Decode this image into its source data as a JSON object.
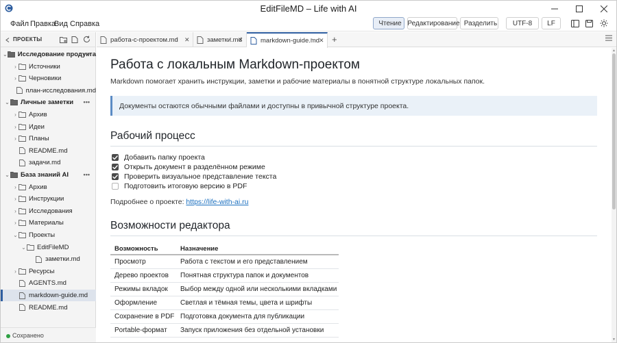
{
  "window": {
    "title": "EditFileMD – Life with AI"
  },
  "menu": [
    "Файл",
    "Правка",
    "Вид",
    "Справка"
  ],
  "toolbar": {
    "read_label": "Чтение",
    "edit_label": "Редактирование",
    "split_label": "Разделить",
    "encoding": "UTF-8",
    "line_ending": "LF"
  },
  "sidebar": {
    "title": "ПРОЕКТЫ",
    "tree": [
      {
        "label": "Исследование продукта",
        "type": "group",
        "indent": 0,
        "expanded": true
      },
      {
        "label": "Источники",
        "type": "folder",
        "indent": 1
      },
      {
        "label": "Черновики",
        "type": "folder",
        "indent": 1
      },
      {
        "label": "план-исследования.md",
        "type": "file",
        "indent": 1
      },
      {
        "label": "Личные заметки",
        "type": "group",
        "indent": 0,
        "expanded": true
      },
      {
        "label": "Архив",
        "type": "folder",
        "indent": 1
      },
      {
        "label": "Идеи",
        "type": "folder",
        "indent": 1
      },
      {
        "label": "Планы",
        "type": "folder",
        "indent": 1
      },
      {
        "label": "README.md",
        "type": "file",
        "indent": 1
      },
      {
        "label": "задачи.md",
        "type": "file",
        "indent": 1
      },
      {
        "label": "База знаний AI",
        "type": "group",
        "indent": 0,
        "expanded": true
      },
      {
        "label": "Архив",
        "type": "folder",
        "indent": 1
      },
      {
        "label": "Инструкции",
        "type": "folder",
        "indent": 1
      },
      {
        "label": "Исследования",
        "type": "folder",
        "indent": 1
      },
      {
        "label": "Материалы",
        "type": "folder",
        "indent": 1
      },
      {
        "label": "Проекты",
        "type": "folder",
        "indent": 1,
        "expanded": true
      },
      {
        "label": "EditFileMD",
        "type": "folder",
        "indent": 2,
        "expanded": true
      },
      {
        "label": "заметки.md",
        "type": "file",
        "indent": 3
      },
      {
        "label": "Ресурсы",
        "type": "folder",
        "indent": 1
      },
      {
        "label": "AGENTS.md",
        "type": "file",
        "indent": 1
      },
      {
        "label": "markdown-guide.md",
        "type": "file",
        "indent": 1,
        "selected": true
      },
      {
        "label": "README.md",
        "type": "file",
        "indent": 1
      }
    ],
    "status": "Сохранено"
  },
  "tabs": [
    {
      "label": "работа-с-проектом.md",
      "active": false
    },
    {
      "label": "заметки.md",
      "active": false
    },
    {
      "label": "markdown-guide.md",
      "active": true
    }
  ],
  "document": {
    "h1": "Работа с локальным Markdown-проектом",
    "lead": "Markdown помогает хранить инструкции, заметки и рабочие материалы в понятной структуре локальных папок.",
    "callout": "Документы остаются обычными файлами и доступны в привычной структуре проекта.",
    "h2_workflow": "Рабочий процесс",
    "tasks": [
      {
        "text": "Добавить папку проекта",
        "done": true
      },
      {
        "text": "Открыть документ в разделённом режиме",
        "done": true
      },
      {
        "text": "Проверить визуальное представление текста",
        "done": true
      },
      {
        "text": "Подготовить итоговую версию в PDF",
        "done": false
      }
    ],
    "more_prefix": "Подробнее о проекте: ",
    "more_link": "https://life-with-ai.ru",
    "h2_features": "Возможности редактора",
    "table_headers": [
      "Возможность",
      "Назначение"
    ],
    "table_rows": [
      [
        "Просмотр",
        "Работа с текстом и его представлением"
      ],
      [
        "Дерево проектов",
        "Понятная структура папок и документов"
      ],
      [
        "Режимы вкладок",
        "Выбор между одной или несколькими вкладками"
      ],
      [
        "Оформление",
        "Светлая и тёмная темы, цвета и шрифты"
      ],
      [
        "Сохранение в PDF",
        "Подготовка документа для публикации"
      ],
      [
        "Portable-формат",
        "Запуск приложения без отдельной установки"
      ]
    ]
  },
  "colors": {
    "accent": "#2d5d9f",
    "link": "#1a6fbf",
    "callout_bg": "#eaf1f8",
    "saved": "#2ea043"
  }
}
